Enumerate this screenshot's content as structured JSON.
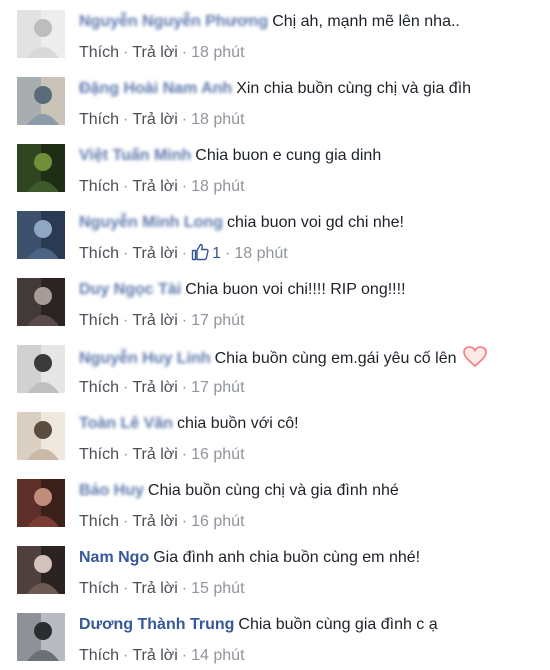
{
  "comments": [
    {
      "author": "Nguyễn Nguyễn Phương",
      "text": "Chị ah, mạnh mẽ lên nha..",
      "like_action": "Thích",
      "reply_action": "Trả lời",
      "time": "18 phút",
      "author_blurred": true
    },
    {
      "author": "Đặng Hoài Nam Anh",
      "text": "Xin chia buồn cùng chị và gia đìh",
      "like_action": "Thích",
      "reply_action": "Trả lời",
      "time": "18 phút",
      "author_blurred": true
    },
    {
      "author": "Việt Tuấn Minh",
      "text": "Chia buon e cung gia dinh",
      "like_action": "Thích",
      "reply_action": "Trả lời",
      "time": "18 phút",
      "author_blurred": true
    },
    {
      "author": "Nguyễn Minh Long",
      "text": "chia buon voi gd chi nhe!",
      "like_action": "Thích",
      "reply_action": "Trả lời",
      "time": "18 phút",
      "like_count": "1",
      "author_blurred": true
    },
    {
      "author": "Duy Ngọc Tài",
      "text": "Chia buon voi chi!!!! RIP ong!!!!",
      "like_action": "Thích",
      "reply_action": "Trả lời",
      "time": "17 phút",
      "author_blurred": true
    },
    {
      "author": "Nguyễn Huy Linh",
      "text": "Chia buồn cùng em.gái yêu cố lên",
      "like_action": "Thích",
      "reply_action": "Trả lời",
      "time": "17 phút",
      "author_blurred": true,
      "has_heart": true
    },
    {
      "author": "Toàn Lê Văn",
      "text": "chia buồn với cô!",
      "like_action": "Thích",
      "reply_action": "Trả lời",
      "time": "16 phút",
      "author_blurred": true
    },
    {
      "author": "Bảo Huy",
      "text": "Chia buồn cùng chị và gia đình nhé",
      "like_action": "Thích",
      "reply_action": "Trả lời",
      "time": "16 phút",
      "author_blurred": true
    },
    {
      "author": "Nam Ngo",
      "text": "Gia đình anh chia buồn cùng em nhé!",
      "like_action": "Thích",
      "reply_action": "Trả lời",
      "time": "15 phút",
      "author_blurred": false
    },
    {
      "author": "Dương Thành Trung",
      "text": "Chia buồn cùng gia đình c ạ",
      "like_action": "Thích",
      "reply_action": "Trả lời",
      "time": "14 phút",
      "author_blurred": false
    }
  ],
  "colors": {
    "author": "#365899",
    "text": "#1d2129",
    "meta": "#90949c",
    "action": "#4b4f56",
    "heart": "#f47a7a"
  },
  "icons": {
    "like": "thumbs-up-icon",
    "heart": "heart-outline-icon"
  }
}
